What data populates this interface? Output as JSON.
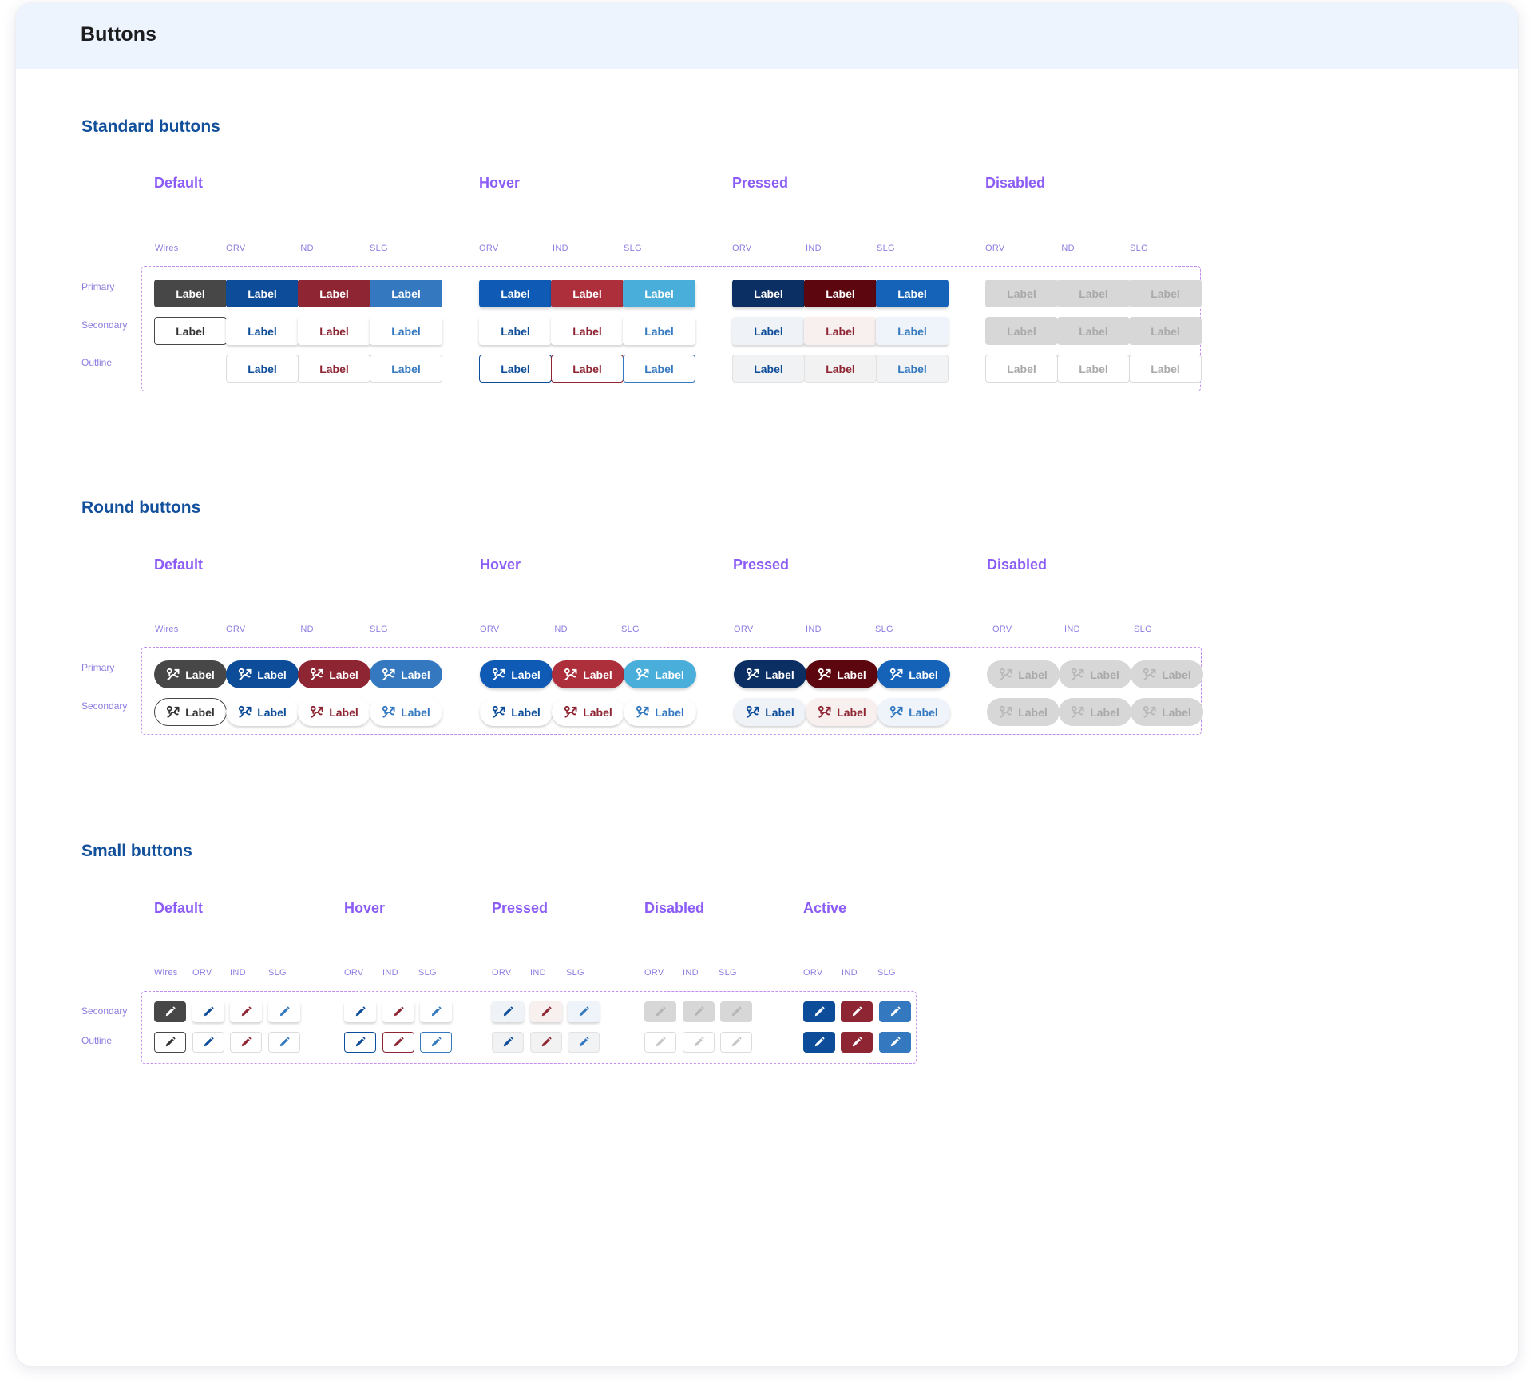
{
  "page_title": "Buttons",
  "button_label": "Label",
  "row_labels": {
    "primary": "Primary",
    "secondary": "Secondary",
    "outline": "Outline"
  },
  "states": {
    "default": "Default",
    "hover": "Hover",
    "pressed": "Pressed",
    "disabled": "Disabled",
    "active": "Active"
  },
  "variants": {
    "wires": "Wires",
    "orv": "ORV",
    "ind": "IND",
    "slg": "SLG"
  },
  "icons": {
    "round_button_icon": "route-icon",
    "small_button_icon": "pencil-icon"
  },
  "sections": {
    "standard": {
      "title": "Standard buttons"
    },
    "round": {
      "title": "Round buttons"
    },
    "small": {
      "title": "Small buttons"
    }
  },
  "colors": {
    "brand_heading": "#12509c",
    "state_heading": "#8b5cf6",
    "guide_border": "#c48ef0",
    "wires": "#474747",
    "orv": "#0c4c99",
    "ind": "#8e2533",
    "slg": "#3479c0",
    "orv_hover": "#0f5ab5",
    "ind_hover": "#ad2f3c",
    "slg_hover": "#4aaedb",
    "orv_pressed": "#0b2f63",
    "ind_pressed": "#5c0710",
    "slg_pressed": "#1563b9",
    "disabled_fill": "#d7d7d7",
    "disabled_text": "#a9a9a9"
  }
}
